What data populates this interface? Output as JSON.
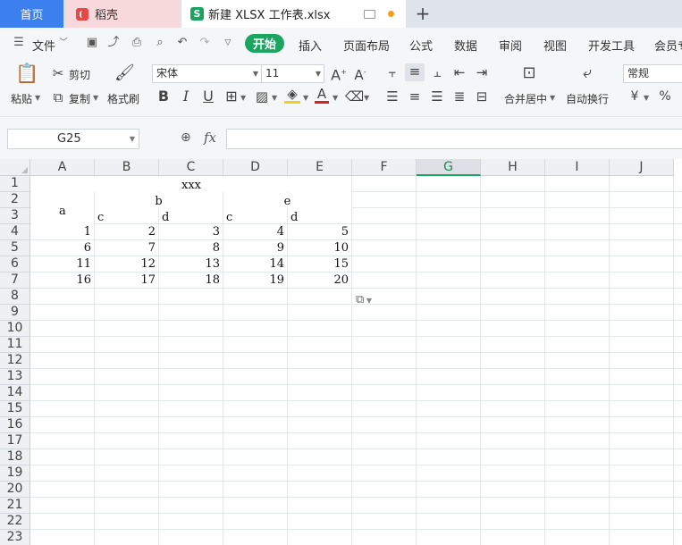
{
  "tabs": {
    "home": "首页",
    "daoke": "稻壳",
    "file": "新建 XLSX 工作表.xlsx",
    "file_icon_letter": "S"
  },
  "menu": {
    "file": "文件",
    "items": [
      "开始",
      "插入",
      "页面布局",
      "公式",
      "数据",
      "审阅",
      "视图",
      "开发工具",
      "会员专"
    ]
  },
  "ribbon": {
    "paste": "粘贴",
    "cut": "剪切",
    "copy": "复制",
    "format_painter": "格式刷",
    "font_name": "宋体",
    "font_size": "11",
    "merge_center": "合并居中",
    "wrap_text": "自动换行",
    "number_format": "常规",
    "currency_symbol": "¥",
    "percent_symbol": "%"
  },
  "formula_bar": {
    "name_box": "G25",
    "fx": "fx",
    "formula": ""
  },
  "grid": {
    "columns": [
      "A",
      "B",
      "C",
      "D",
      "E",
      "F",
      "G",
      "H",
      "I",
      "J"
    ],
    "selected_column": "G",
    "rows": [
      "1",
      "2",
      "3",
      "4",
      "5",
      "6",
      "7",
      "8",
      "9",
      "10",
      "11",
      "12",
      "13",
      "14",
      "15",
      "16",
      "17",
      "18",
      "19",
      "20",
      "21",
      "22",
      "23"
    ],
    "headers": {
      "title": "xxx",
      "a": "a",
      "b": "b",
      "e": "e",
      "c1": "c",
      "d1": "d",
      "c2": "c",
      "d2": "d"
    },
    "data": [
      [
        "1",
        "2",
        "3",
        "4",
        "5"
      ],
      [
        "6",
        "7",
        "8",
        "9",
        "10"
      ],
      [
        "11",
        "12",
        "13",
        "14",
        "15"
      ],
      [
        "16",
        "17",
        "18",
        "19",
        "20"
      ]
    ]
  },
  "colors": {
    "accent_green": "#1aa660",
    "home_tab_blue": "#3c80f0"
  }
}
